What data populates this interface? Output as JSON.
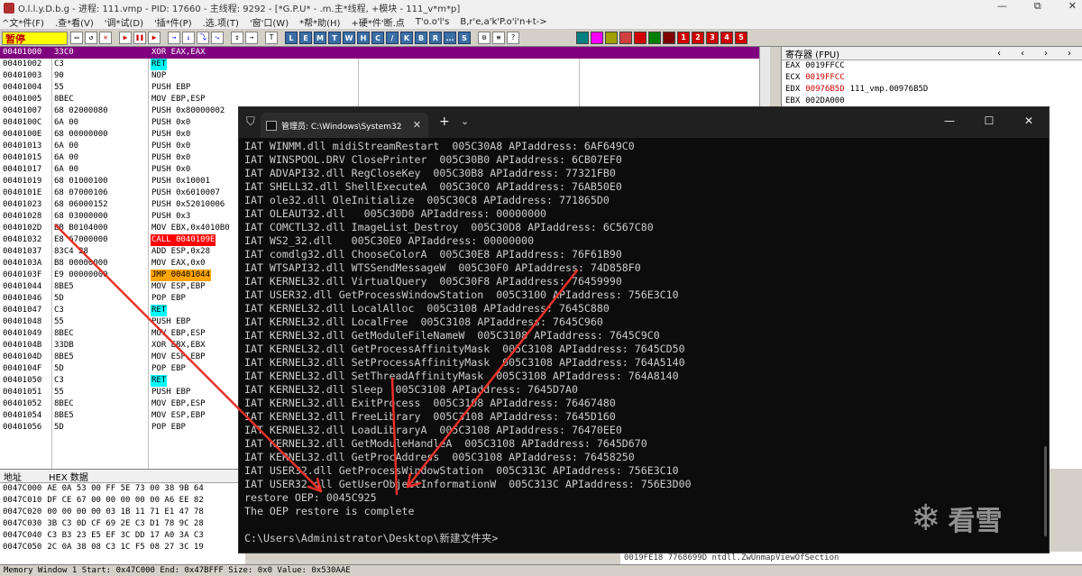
{
  "olly": {
    "title": "O.l.l.y.D.b.g - 进程: 111.vmp - PID: 17660 - 主线程: 9292 - [*G.P.U* - .m.主*线程, +模块 - 111_v*m*p]",
    "title_controls": [
      "—",
      "⧉",
      "✕"
    ],
    "menu": [
      "^文*件(F)",
      ".查*看(V)",
      "'调*试(D)",
      "'插*件(P)",
      ".选.项(T)",
      "'窗'口(W)",
      "*帮*助(H)",
      "+硬*件'断.点",
      "T'o.o'l's",
      "B,r'e,a'k'P.o'i'n+t->"
    ],
    "status_paused": "暂停",
    "toolbar_letters": [
      "L",
      "E",
      "M",
      "T",
      "W",
      "H",
      "C",
      "/",
      "K",
      "B",
      "R",
      "...",
      "S"
    ],
    "toolbar_colors": [
      {
        "label": "",
        "color": "#008080"
      },
      {
        "label": "",
        "color": "#ff00ff"
      },
      {
        "label": "",
        "color": "#a0a000"
      },
      {
        "label": "",
        "color": "#d04040"
      },
      {
        "label": "",
        "color": "#d00000"
      },
      {
        "label": "",
        "color": "#008000"
      },
      {
        "label": "",
        "color": "#800000"
      },
      {
        "label": "1",
        "color": "#d00000"
      },
      {
        "label": "2",
        "color": "#d00000"
      },
      {
        "label": "3",
        "color": "#d00000"
      },
      {
        "label": "4",
        "color": "#d00000"
      },
      {
        "label": "5",
        "color": "#d00000"
      }
    ],
    "disasm": [
      {
        "addr": "00401000",
        "hex": "33C0",
        "asm": "XOR EAX,EAX",
        "hl": "",
        "sel": true
      },
      {
        "addr": "00401002",
        "hex": "C3",
        "asm": "RET",
        "hl": "cyan",
        "sel": false
      },
      {
        "addr": "00401003",
        "hex": "90",
        "asm": "NOP",
        "hl": "",
        "sel": false
      },
      {
        "addr": "00401004",
        "hex": "55",
        "asm": "PUSH EBP",
        "hl": "",
        "sel": false
      },
      {
        "addr": "00401005",
        "hex": "8BEC",
        "asm": "MOV EBP,ESP",
        "hl": "",
        "sel": false
      },
      {
        "addr": "00401007",
        "hex": "68 02000080",
        "asm": "PUSH 0x80000002",
        "hl": "",
        "sel": false
      },
      {
        "addr": "0040100C",
        "hex": "6A 00",
        "asm": "PUSH 0x0",
        "hl": "",
        "sel": false
      },
      {
        "addr": "0040100E",
        "hex": "68 00000000",
        "asm": "PUSH 0x0",
        "hl": "",
        "sel": false
      },
      {
        "addr": "00401013",
        "hex": "6A 00",
        "asm": "PUSH 0x0",
        "hl": "",
        "sel": false
      },
      {
        "addr": "00401015",
        "hex": "6A 00",
        "asm": "PUSH 0x0",
        "hl": "",
        "sel": false
      },
      {
        "addr": "00401017",
        "hex": "6A 00",
        "asm": "PUSH 0x0",
        "hl": "",
        "sel": false
      },
      {
        "addr": "00401019",
        "hex": "68 01000100",
        "asm": "PUSH 0x10001",
        "hl": "",
        "sel": false
      },
      {
        "addr": "0040101E",
        "hex": "68 07000106",
        "asm": "PUSH 0x6010007",
        "hl": "",
        "sel": false
      },
      {
        "addr": "00401023",
        "hex": "68 06000152",
        "asm": "PUSH 0x52010006",
        "hl": "",
        "sel": false
      },
      {
        "addr": "00401028",
        "hex": "68 03000000",
        "asm": "PUSH 0x3",
        "hl": "",
        "sel": false
      },
      {
        "addr": "0040102D",
        "hex": "BB B0104000",
        "asm": "MOV EBX,0x4010B0",
        "hl": "",
        "sel": false
      },
      {
        "addr": "00401032",
        "hex": "E8 67000000",
        "asm": "CALL 0040109E",
        "hl": "red",
        "sel": false
      },
      {
        "addr": "00401037",
        "hex": "83C4 28",
        "asm": "ADD ESP,0x28",
        "hl": "",
        "sel": false
      },
      {
        "addr": "0040103A",
        "hex": "B8 00000000",
        "asm": "MOV EAX,0x0",
        "hl": "",
        "sel": false
      },
      {
        "addr": "0040103F",
        "hex": "E9 00000000",
        "asm": "JMP 00401044",
        "hl": "orange",
        "sel": false
      },
      {
        "addr": "00401044",
        "hex": "8BE5",
        "asm": "MOV ESP,EBP",
        "hl": "",
        "sel": false
      },
      {
        "addr": "00401046",
        "hex": "5D",
        "asm": "POP EBP",
        "hl": "",
        "sel": false
      },
      {
        "addr": "00401047",
        "hex": "C3",
        "asm": "RET",
        "hl": "cyan",
        "sel": false
      },
      {
        "addr": "00401048",
        "hex": "55",
        "asm": "PUSH EBP",
        "hl": "",
        "sel": false
      },
      {
        "addr": "00401049",
        "hex": "8BEC",
        "asm": "MOV EBP,ESP",
        "hl": "",
        "sel": false
      },
      {
        "addr": "0040104B",
        "hex": "33DB",
        "asm": "XOR EBX,EBX",
        "hl": "",
        "sel": false
      },
      {
        "addr": "0040104D",
        "hex": "8BE5",
        "asm": "MOV ESP,EBP",
        "hl": "",
        "sel": false
      },
      {
        "addr": "0040104F",
        "hex": "5D",
        "asm": "POP EBP",
        "hl": "",
        "sel": false
      },
      {
        "addr": "00401050",
        "hex": "C3",
        "asm": "RET",
        "hl": "cyan",
        "sel": false
      },
      {
        "addr": "00401051",
        "hex": "55",
        "asm": "PUSH EBP",
        "hl": "",
        "sel": false
      },
      {
        "addr": "00401052",
        "hex": "8BEC",
        "asm": "MOV EBP,ESP",
        "hl": "",
        "sel": false
      },
      {
        "addr": "00401054",
        "hex": "8BE5",
        "asm": "MOV ESP,EBP",
        "hl": "",
        "sel": false
      },
      {
        "addr": "00401056",
        "hex": "5D",
        "asm": "POP EBP",
        "hl": "",
        "sel": false
      }
    ],
    "registers_title": "寄存器 (FPU)",
    "registers": [
      {
        "name": "EAX",
        "value": "0019FFCC",
        "extra": "",
        "red": false
      },
      {
        "name": "ECX",
        "value": "0019FFCC",
        "extra": "",
        "red": true
      },
      {
        "name": "EDX",
        "value": "00976B5D",
        "extra": "111_vmp.00976B5D",
        "red": true
      },
      {
        "name": "EBX",
        "value": "002DA000",
        "extra": "",
        "red": false
      }
    ],
    "hex_headers": [
      "地址",
      "HEX 数据"
    ],
    "hex_rows": [
      {
        "addr": "0047C000",
        "bytes": "AE 0A 53 00 FF 5E 73 00 38 9B 64"
      },
      {
        "addr": "0047C010",
        "bytes": "DF CE 67 00 00 00 00 00 A6 EE 82"
      },
      {
        "addr": "0047C020",
        "bytes": "00 00 00 00 03 1B 11 71 E1 47 78"
      },
      {
        "addr": "0047C030",
        "bytes": "3B C3 0D CF 69 2E C3 D1 78 9C 28"
      },
      {
        "addr": "0047C040",
        "bytes": "C3 B3 23 E5 EF 3C DD 17 A0 3A C3"
      },
      {
        "addr": "0047C050",
        "bytes": "2C 0A 38 08 C3 1C F5 08 27 3C 19"
      }
    ],
    "stack_line": "0019FE18  7768699D ntdll.ZwUnmapViewOfSection",
    "statusbar": "Memory Window 1  Start: 0x47C000  End: 0x47BFFF  Size: 0x0 Value: 0x530AAE"
  },
  "terminal": {
    "tab_title": "管理员: C:\\Windows\\System32",
    "tab_close": "✕",
    "new_tab": "+",
    "dropdown": "⌄",
    "controls": [
      "—",
      "☐",
      "✕"
    ],
    "lines": [
      "IAT WINMM.dll midiStreamRestart  005C30A8 APIaddress: 6AF649C0",
      "IAT WINSPOOL.DRV ClosePrinter  005C30B0 APIaddress: 6CB07EF0",
      "IAT ADVAPI32.dll RegCloseKey  005C30B8 APIaddress: 77321FB0",
      "IAT SHELL32.dll ShellExecuteA  005C30C0 APIaddress: 76AB50E0",
      "IAT ole32.dll OleInitialize  005C30C8 APIaddress: 771865D0",
      "IAT OLEAUT32.dll   005C30D0 APIaddress: 00000000",
      "IAT COMCTL32.dll ImageList_Destroy  005C30D8 APIaddress: 6C567C80",
      "IAT WS2_32.dll   005C30E0 APIaddress: 00000000",
      "IAT comdlg32.dll ChooseColorA  005C30E8 APIaddress: 76F61B90",
      "IAT WTSAPI32.dll WTSSendMessageW  005C30F0 APIaddress: 74D858F0",
      "IAT KERNEL32.dll VirtualQuery  005C30F8 APIaddress: 76459990",
      "IAT USER32.dll GetProcessWindowStation  005C3100 APIaddress: 756E3C10",
      "IAT KERNEL32.dll LocalAlloc  005C3108 APIaddress: 7645C880",
      "IAT KERNEL32.dll LocalFree  005C3108 APIaddress: 7645C960",
      "IAT KERNEL32.dll GetModuleFileNameW  005C3108 APIaddress: 7645C9C0",
      "IAT KERNEL32.dll GetProcessAffinityMask  005C3108 APIaddress: 7645CD50",
      "IAT KERNEL32.dll SetProcessAffinityMask  005C3108 APIaddress: 764A5140",
      "IAT KERNEL32.dll SetThreadAffinityMask  005C3108 APIaddress: 764A8140",
      "IAT KERNEL32.dll Sleep  005C3108 APIaddress: 7645D7A0",
      "IAT KERNEL32.dll ExitProcess  005C3108 APIaddress: 76467480",
      "IAT KERNEL32.dll FreeLibrary  005C3108 APIaddress: 7645D160",
      "IAT KERNEL32.dll LoadLibraryA  005C3108 APIaddress: 76470EE0",
      "IAT KERNEL32.dll GetModuleHandleA  005C3108 APIaddress: 7645D670",
      "IAT KERNEL32.dll GetProcAddress  005C3108 APIaddress: 76458250",
      "IAT USER32.dll GetProcessWindowStation  005C313C APIaddress: 756E3C10",
      "IAT USER32.dll GetUserObjectInformationW  005C313C APIaddress: 756E3D00",
      "restore OEP: 0045C925",
      "The OEP restore is complete",
      "",
      "C:\\Users\\Administrator\\Desktop\\新建文件夹>"
    ]
  },
  "watermark": {
    "text": "看雪",
    "flake": "❄"
  }
}
